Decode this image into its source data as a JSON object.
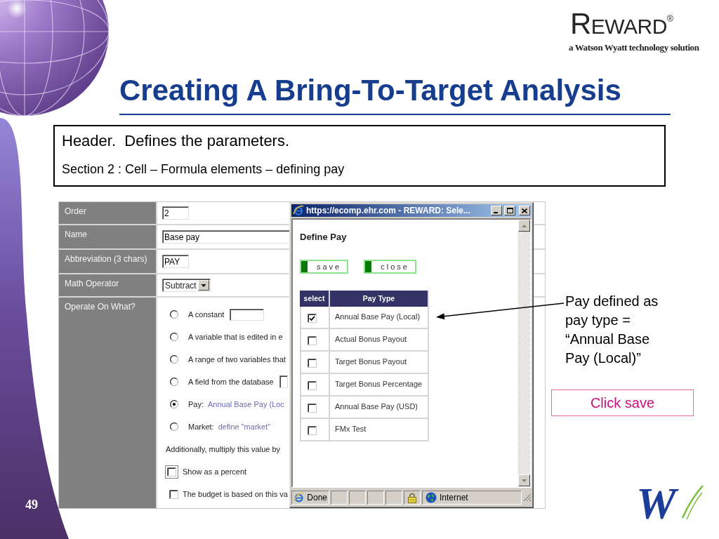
{
  "logo": {
    "wordmark": "REWARD$^{®}$",
    "tagline": "a Watson Wyatt technology solution"
  },
  "title": "Creating A Bring-To-Target Analysis",
  "header_box": {
    "lines": [
      "Header.  Defines the parameters.",
      "Section 2 : Cell – Formula elements – defining pay"
    ]
  },
  "form": {
    "fields": [
      {
        "label": "Order",
        "kind": "input",
        "value": "2"
      },
      {
        "label": "Name",
        "kind": "input",
        "value": "Base pay"
      },
      {
        "label": "Abbreviation (3 chars)",
        "kind": "input",
        "value": "PAY"
      },
      {
        "label": "Math Operator",
        "kind": "select",
        "value": "Subtract"
      },
      {
        "label": "Operate On What?",
        "kind": "options",
        "options": [
          {
            "kind": "input",
            "label": "A constant",
            "selected": false
          },
          {
            "kind": "text",
            "label": "A variable that is edited in e",
            "selected": false
          },
          {
            "kind": "text",
            "label": "A range of two variables that",
            "selected": false
          },
          {
            "kind": "select",
            "label": "A field from the database",
            "selected": false
          },
          {
            "kind": "link",
            "label": "Pay:",
            "link": "Annual Base Pay (Loc",
            "selected": true
          },
          {
            "kind": "link",
            "label": "Market:",
            "link": "define \"market\"",
            "selected": false
          }
        ],
        "note": "Additionally, multiply this value by",
        "checkboxes": [
          {
            "label": "Show as a percent",
            "checked": false,
            "focused": true
          },
          {
            "label": "The budget is based on this va",
            "checked": false,
            "focused": false
          }
        ]
      }
    ]
  },
  "popup": {
    "title": "https://ecomp.ehr.com - REWARD: Sele...",
    "heading": "Define Pay",
    "buttons": [
      "save",
      "close"
    ],
    "columns": [
      "select",
      "Pay Type"
    ],
    "rows": [
      {
        "pay_type": "Annual Base Pay (Local)",
        "checked": true
      },
      {
        "pay_type": "Actual Bonus Payout",
        "checked": false
      },
      {
        "pay_type": "Target Bonus Payout",
        "checked": false
      },
      {
        "pay_type": "Target Bonus Percentage",
        "checked": false
      },
      {
        "pay_type": "Annual Base Pay (USD)",
        "checked": false
      },
      {
        "pay_type": "FMx Test",
        "checked": false
      }
    ],
    "status": {
      "text": "Done",
      "zone": "Internet"
    }
  },
  "annotation": {
    "text": "Pay defined as pay type = “Annual Base Pay (Local)”",
    "callout": "Click save"
  },
  "page_number": "49",
  "footer_logo": {
    "text": "W"
  }
}
